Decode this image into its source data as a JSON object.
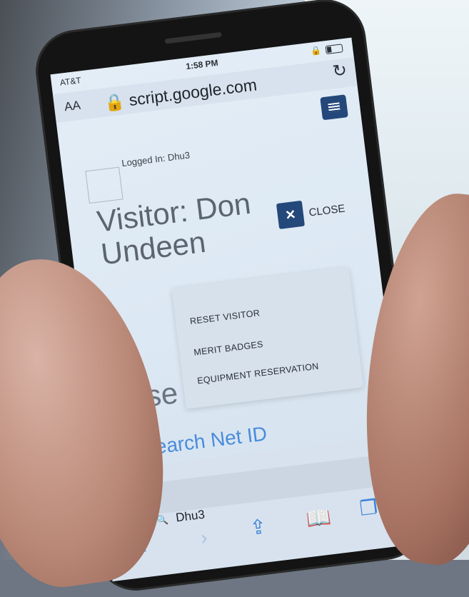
{
  "status_bar": {
    "carrier": "AT&T",
    "time": "1:58 PM"
  },
  "address_bar": {
    "text_size_label": "AA",
    "url": "script.google.com"
  },
  "header": {
    "logged_in_text": "Logged In: Dhu3"
  },
  "visitor": {
    "title": "Visitor: Don Undeen",
    "close_label": "CLOSE"
  },
  "dropdown": {
    "items": [
      "RESET VISITOR",
      "MERIT BADGES",
      "EQUIPMENT RESERVATION"
    ]
  },
  "main": {
    "heading": "Use",
    "search_link": "Search Net ID"
  },
  "bottom": {
    "search_value": "Dhu3"
  },
  "icons": {
    "menu": "hamburger-icon",
    "reload": "reload-icon",
    "close": "close-icon",
    "back": "back-icon",
    "forward": "forward-icon",
    "share": "share-icon",
    "bookmarks": "bookmarks-icon",
    "tabs": "tabs-icon"
  },
  "colors": {
    "accent": "#24487a",
    "link": "#4a8bdc"
  }
}
